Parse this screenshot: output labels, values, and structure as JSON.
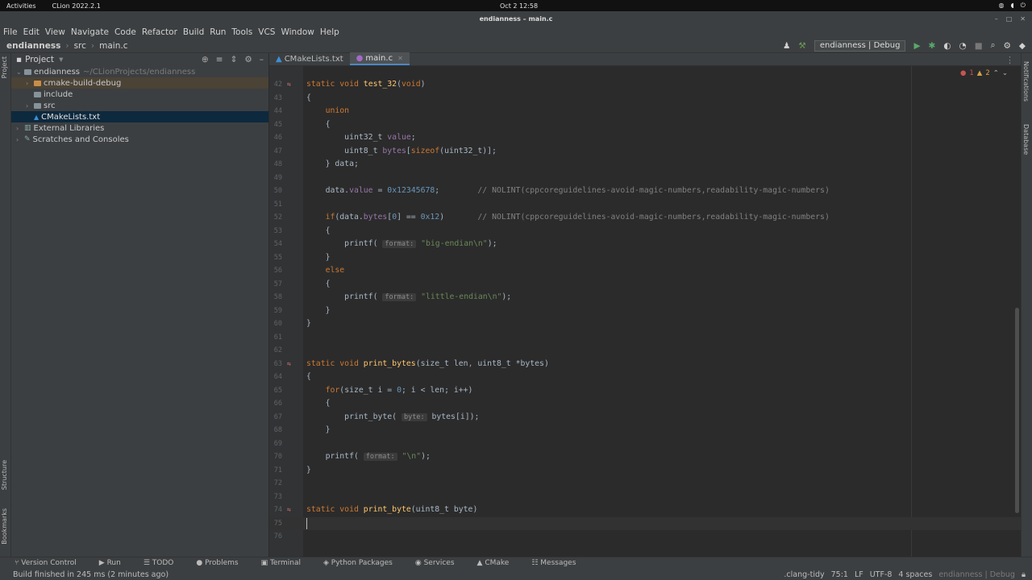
{
  "system_bar": {
    "activities": "Activities",
    "app_name": "CLion 2022.2.1",
    "clock": "Oct 2  12:58"
  },
  "window": {
    "title": "endianness – main.c"
  },
  "menu": [
    "File",
    "Edit",
    "View",
    "Navigate",
    "Code",
    "Refactor",
    "Build",
    "Run",
    "Tools",
    "VCS",
    "Window",
    "Help"
  ],
  "breadcrumb": [
    "endianness",
    "src",
    "main.c"
  ],
  "run_config": "endianness | Debug",
  "left_strip": [
    "Project",
    "Structure",
    "Bookmarks"
  ],
  "right_strip": [
    "Notifications",
    "Database"
  ],
  "project": {
    "header": "Project",
    "tree": [
      {
        "label": "endianness",
        "hint": "~/CLionProjects/endianness",
        "indent": 0,
        "arrow": "⌄",
        "kind": "folder"
      },
      {
        "label": "cmake-build-debug",
        "hint": "",
        "indent": 1,
        "arrow": "›",
        "kind": "folder-orange"
      },
      {
        "label": "include",
        "hint": "",
        "indent": 1,
        "arrow": "",
        "kind": "folder"
      },
      {
        "label": "src",
        "hint": "",
        "indent": 1,
        "arrow": "›",
        "kind": "folder"
      },
      {
        "label": "CMakeLists.txt",
        "hint": "",
        "indent": 1,
        "arrow": "",
        "kind": "file"
      },
      {
        "label": "External Libraries",
        "hint": "",
        "indent": 0,
        "arrow": "›",
        "kind": "lib"
      },
      {
        "label": "Scratches and Consoles",
        "hint": "",
        "indent": 0,
        "arrow": "›",
        "kind": "scratch"
      }
    ]
  },
  "tabs": [
    {
      "label": "CMakeLists.txt",
      "active": false
    },
    {
      "label": "main.c",
      "active": true
    }
  ],
  "inspections": {
    "errors": "1",
    "warnings": "2"
  },
  "code_lines": [
    {
      "n": "42",
      "html": "<span class='kw'>static void</span> <span class='fn'>test_32</span>(<span class='kw'>void</span>)",
      "icon": true
    },
    {
      "n": "43",
      "html": "{"
    },
    {
      "n": "44",
      "html": "    <span class='kw'>union</span>"
    },
    {
      "n": "45",
      "html": "    {"
    },
    {
      "n": "46",
      "html": "        uint32_t <span class='fld'>value</span>;"
    },
    {
      "n": "47",
      "html": "        uint8_t <span class='fld'>bytes</span>[<span class='kw'>sizeof</span>(uint32_t)];"
    },
    {
      "n": "48",
      "html": "    } data;"
    },
    {
      "n": "49",
      "html": ""
    },
    {
      "n": "50",
      "html": "    data.<span class='fld'>value</span> = <span class='num'>0x12345678</span>;        <span class='cmt'>// NOLINT(cppcoreguidelines-avoid-magic-numbers,readability-magic-numbers)</span>"
    },
    {
      "n": "51",
      "html": ""
    },
    {
      "n": "52",
      "html": "    <span class='kw'>if</span>(data.<span class='fld'>bytes</span>[<span class='num'>0</span>] == <span class='num'>0x12</span>)       <span class='cmt'>// NOLINT(cppcoreguidelines-avoid-magic-numbers,readability-magic-numbers)</span>"
    },
    {
      "n": "53",
      "html": "    {"
    },
    {
      "n": "54",
      "html": "        printf( <span class='hint-box'>format:</span> <span class='str'>\"big-endian\\n\"</span>);"
    },
    {
      "n": "55",
      "html": "    }"
    },
    {
      "n": "56",
      "html": "    <span class='kw'>else</span>"
    },
    {
      "n": "57",
      "html": "    {"
    },
    {
      "n": "58",
      "html": "        printf( <span class='hint-box'>format:</span> <span class='str'>\"little-endian\\n\"</span>);"
    },
    {
      "n": "59",
      "html": "    }"
    },
    {
      "n": "60",
      "html": "}"
    },
    {
      "n": "61",
      "html": ""
    },
    {
      "n": "62",
      "html": ""
    },
    {
      "n": "63",
      "html": "<span class='kw'>static void</span> <span class='fn'>print_bytes</span>(size_t len<span class='par'>,</span> uint8_t *bytes)",
      "icon": true
    },
    {
      "n": "64",
      "html": "{"
    },
    {
      "n": "65",
      "html": "    <span class='kw'>for</span>(size_t i = <span class='num'>0</span>; i &lt; len; i++)"
    },
    {
      "n": "66",
      "html": "    {"
    },
    {
      "n": "67",
      "html": "        print_byte( <span class='hint-box'>byte:</span> bytes[i]);"
    },
    {
      "n": "68",
      "html": "    }"
    },
    {
      "n": "69",
      "html": ""
    },
    {
      "n": "70",
      "html": "    printf( <span class='hint-box'>format:</span> <span class='str'>\"\\n\"</span>);"
    },
    {
      "n": "71",
      "html": "}"
    },
    {
      "n": "72",
      "html": ""
    },
    {
      "n": "73",
      "html": ""
    },
    {
      "n": "74",
      "html": "<span class='kw'>static void</span> <span class='fn'>print_byte</span>(uint8_t byte)",
      "icon": true
    },
    {
      "n": "75",
      "html": "",
      "current": true
    },
    {
      "n": "76",
      "html": ""
    }
  ],
  "tool_windows": [
    "Version Control",
    "Run",
    "TODO",
    "Problems",
    "Terminal",
    "Python Packages",
    "Services",
    "CMake",
    "Messages"
  ],
  "status": {
    "message": "Build finished in 245 ms (2 minutes ago)",
    "linter": ".clang-tidy",
    "position": "75:1",
    "line_sep": "LF",
    "encoding": "UTF-8",
    "indent": "4 spaces",
    "context": "endianness | Debug"
  }
}
